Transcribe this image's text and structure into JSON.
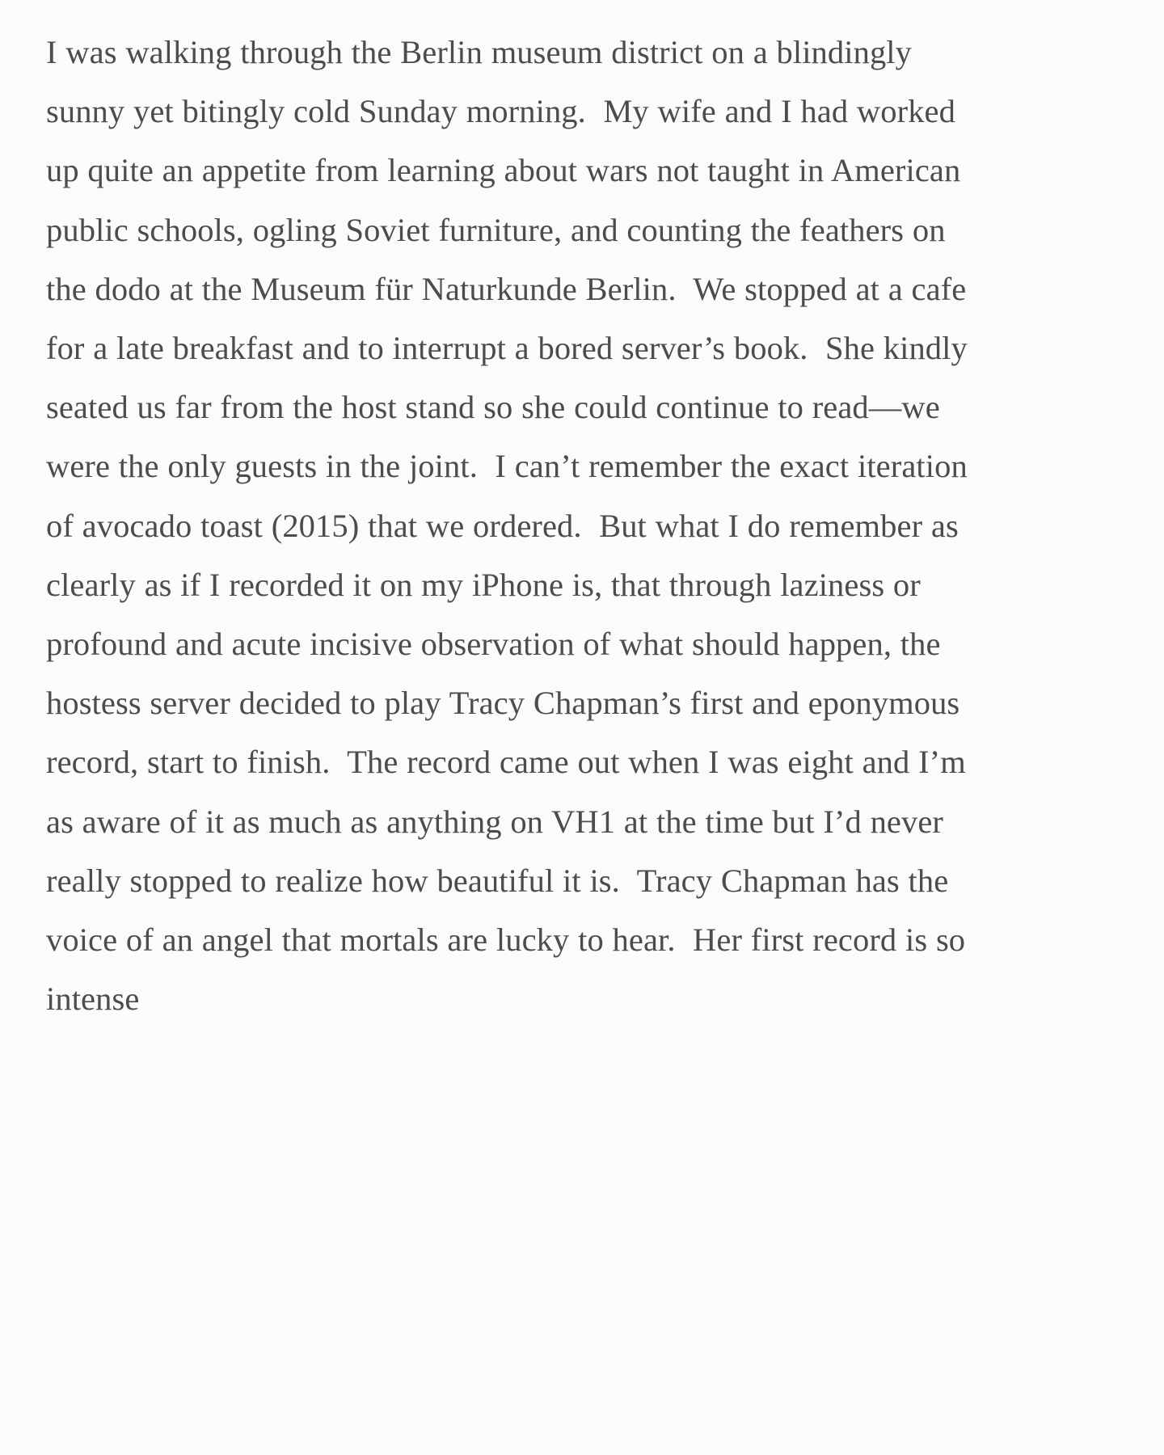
{
  "document": {
    "type": "prose-excerpt",
    "background_color": "#fbfbfa",
    "text_color": "#4c4c4c",
    "body_text": "I was walking through the Berlin museum district on a blindingly sunny yet bitingly cold Sunday morning.  My wife and I had worked up quite an appetite from learning about wars not taught in American public schools, ogling Soviet furniture, and counting the feathers on the dodo at the Museum für Naturkunde Berlin.  We stopped at a cafe for a late breakfast and to interrupt a bored server’s book.  She kindly seated us far from the host stand so she could continue to read—we were the only guests in the joint.  I can’t remember the exact iteration of avocado toast (2015) that we ordered.  But what I do remember as clearly as if I recorded it on my iPhone is, that through laziness or profound and acute incisive observation of what should happen, the hostess server decided to play Tracy Chapman’s first and eponymous record, start to finish.  The record came out when I was eight and I’m as aware of it as much as anything on VH1 at the time but I’d never really stopped to realize how beautiful it is.  Tracy Chapman has the voice of an angel that mortals are lucky to hear.  Her first record is so intense",
    "lines": [
      "I was walking through the Berlin museum district on a",
      "blindingly sunny yet bitingly cold Sunday morning.  My",
      "wife and I had worked up quite an appetite from",
      "learning about wars not taught in American public",
      "schools, ogling Soviet furniture, and counting the",
      "feathers on the dodo at the Museum für Naturkunde",
      "Berlin.  We stopped at a cafe for a late breakfast and to",
      "interrupt a bored server’s book.  She kindly seated us",
      "far from the host stand so she could continue to read—",
      "we were the only guests in the joint.  I can’t remember",
      "the exact iteration of avocado toast (2015) that we",
      "ordered.  But what I do remember as clearly as if I",
      "recorded it on my iPhone is, that through laziness or",
      "profound and acute incisive observation of what",
      "should happen, the hostess server decided to play",
      "Tracy Chapman’s first and eponymous record, start to",
      "finish.  The record came out when I was eight and I’m",
      "as aware of it as much as anything on VH1 at the time",
      "but I’d never really stopped to realize how beautiful it",
      "is.  Tracy Chapman has the voice of an angel that",
      "mortals are lucky to hear.  Her first record is so intense"
    ]
  }
}
